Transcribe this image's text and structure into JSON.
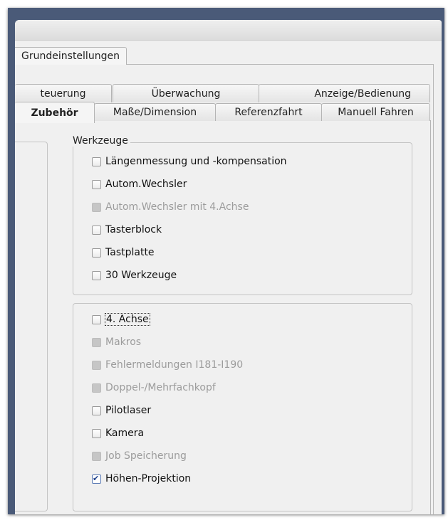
{
  "window": {
    "top_tab": "Grundeinstellungen"
  },
  "tabs_back": [
    "teuerung",
    "Überwachung",
    "Anzeige/Bedienung"
  ],
  "tabs_front": [
    "Zubehör",
    "Maße/Dimension",
    "Referenzfahrt",
    "Manuell Fahren"
  ],
  "active_tab": "Zubehör",
  "werkzeuge": {
    "title": "Werkzeuge",
    "items": [
      {
        "label": "Längenmessung und -kompensation",
        "checked": false,
        "enabled": true
      },
      {
        "label": "Autom.Wechsler",
        "checked": false,
        "enabled": true
      },
      {
        "label": "Autom.Wechsler mit 4.Achse",
        "checked": false,
        "enabled": false
      },
      {
        "label": "Tasterblock",
        "checked": false,
        "enabled": true
      },
      {
        "label": "Tastplatte",
        "checked": false,
        "enabled": true
      },
      {
        "label": "30 Werkzeuge",
        "checked": false,
        "enabled": true
      }
    ]
  },
  "extras": {
    "items": [
      {
        "label": "4. Achse",
        "checked": false,
        "enabled": true,
        "focused": true
      },
      {
        "label": "Makros",
        "checked": false,
        "enabled": false
      },
      {
        "label": "Fehlermeldungen I181-I190",
        "checked": false,
        "enabled": false
      },
      {
        "label": "Doppel-/Mehrfachkopf",
        "checked": false,
        "enabled": false
      },
      {
        "label": "Pilotlaser",
        "checked": false,
        "enabled": true
      },
      {
        "label": "Kamera",
        "checked": false,
        "enabled": true
      },
      {
        "label": "Job Speicherung",
        "checked": false,
        "enabled": false
      },
      {
        "label": "Höhen-Projektion",
        "checked": true,
        "enabled": true
      }
    ]
  },
  "colors": {
    "frame": "#4a5a78",
    "window_bg": "#f0f0f0",
    "disabled_text": "#9c9c9c",
    "check_mark": "#1b3f8a"
  }
}
